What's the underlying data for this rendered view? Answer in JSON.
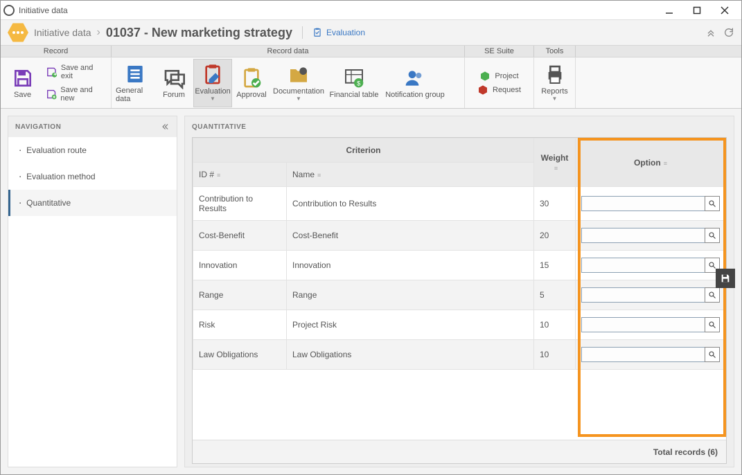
{
  "window": {
    "title": "Initiative data"
  },
  "breadcrumb": {
    "level1": "Initiative data",
    "level2": "01037 - New marketing strategy",
    "crumb_label": "Evaluation"
  },
  "ribbon": {
    "tabs": {
      "record": "Record",
      "record_data": "Record data",
      "se_suite": "SE Suite",
      "tools": "Tools"
    },
    "save": "Save",
    "save_exit": "Save and exit",
    "save_new": "Save and new",
    "general_data": "General data",
    "forum": "Forum",
    "evaluation": "Evaluation",
    "approval": "Approval",
    "documentation": "Documentation",
    "financial_table": "Financial table",
    "notification_group": "Notification group",
    "project": "Project",
    "request": "Request",
    "reports": "Reports"
  },
  "nav": {
    "heading": "NAVIGATION",
    "items": [
      "Evaluation route",
      "Evaluation method",
      "Quantitative"
    ]
  },
  "main": {
    "heading": "QUANTITATIVE",
    "columns": {
      "criterion": "Criterion",
      "id": "ID #",
      "name": "Name",
      "weight": "Weight",
      "option": "Option"
    },
    "rows": [
      {
        "id": "Contribution to Results",
        "name": "Contribution to Results",
        "weight": "30",
        "option": ""
      },
      {
        "id": "Cost-Benefit",
        "name": "Cost-Benefit",
        "weight": "20",
        "option": ""
      },
      {
        "id": "Innovation",
        "name": "Innovation",
        "weight": "15",
        "option": ""
      },
      {
        "id": "Range",
        "name": "Range",
        "weight": "5",
        "option": ""
      },
      {
        "id": "Risk",
        "name": "Project Risk",
        "weight": "10",
        "option": ""
      },
      {
        "id": "Law Obligations",
        "name": "Law Obligations",
        "weight": "10",
        "option": ""
      }
    ],
    "footer": "Total records (6)"
  }
}
